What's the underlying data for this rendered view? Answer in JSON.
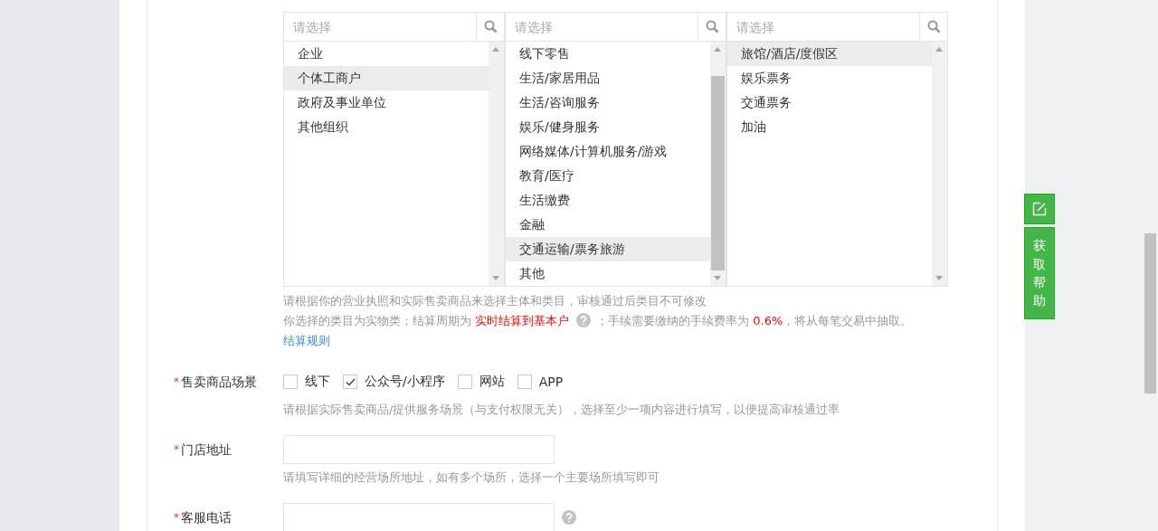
{
  "selectors": [
    {
      "placeholder": "请选择",
      "scrollable": false,
      "items": [
        {
          "label": "企业",
          "selected": false
        },
        {
          "label": "个体工商户",
          "selected": true
        },
        {
          "label": "政府及事业单位",
          "selected": false
        },
        {
          "label": "其他组织",
          "selected": false
        }
      ]
    },
    {
      "placeholder": "请选择",
      "scrollable": true,
      "items": [
        {
          "label": "线下零售",
          "selected": false
        },
        {
          "label": "生活/家居用品",
          "selected": false
        },
        {
          "label": "生活/咨询服务",
          "selected": false
        },
        {
          "label": "娱乐/健身服务",
          "selected": false
        },
        {
          "label": "网络媒体/计算机服务/游戏",
          "selected": false
        },
        {
          "label": "教育/医疗",
          "selected": false
        },
        {
          "label": "生活缴费",
          "selected": false
        },
        {
          "label": "金融",
          "selected": false
        },
        {
          "label": "交通运输/票务旅游",
          "selected": true
        },
        {
          "label": "其他",
          "selected": false
        }
      ]
    },
    {
      "placeholder": "请选择",
      "scrollable": false,
      "items": [
        {
          "label": "旅馆/酒店/度假区",
          "selected": true
        },
        {
          "label": "娱乐票务",
          "selected": false
        },
        {
          "label": "交通票务",
          "selected": false
        },
        {
          "label": "加油",
          "selected": false
        }
      ]
    }
  ],
  "category_notes": [
    {
      "segments": [
        {
          "kind": "plain",
          "text": "请根据你的营业执照和实际售卖商品来选择主体和类目，审核通过后类目不可修改"
        }
      ]
    },
    {
      "segments": [
        {
          "kind": "plain",
          "text": "你选择的类目为实物类；结算周期为 "
        },
        {
          "kind": "highlight",
          "text": "实时结算到基本户"
        },
        {
          "kind": "help"
        },
        {
          "kind": "plain",
          "text": "；手续需要缴纳的手续费率为 "
        },
        {
          "kind": "highlight",
          "text": "0.6%"
        },
        {
          "kind": "plain",
          "text": "，将从每笔交易中抽取。 "
        },
        {
          "kind": "link",
          "text": "结算规则"
        }
      ]
    }
  ],
  "fields": [
    {
      "kind": "checkboxes",
      "label": "售卖商品场景",
      "required_mark": "*",
      "options": [
        {
          "label": "线下",
          "checked": false
        },
        {
          "label": "公众号/小程序",
          "checked": true
        },
        {
          "label": "网站",
          "checked": false
        },
        {
          "label": "APP",
          "checked": false
        }
      ],
      "hint": "请根据实际售卖商品/提供服务场景（与支付权限无关），选择至少一项内容进行填写，以便提高审核通过率"
    },
    {
      "kind": "input",
      "label": "门店地址",
      "required_mark": "*",
      "help_icon": false,
      "hint": "请填写详细的经营场所地址，如有多个场所，选择一个主要场所填写即可"
    },
    {
      "kind": "input",
      "label": "客服电话",
      "required_mark": "*",
      "help_icon": true
    }
  ],
  "side_help": {
    "label": "获取帮助"
  }
}
